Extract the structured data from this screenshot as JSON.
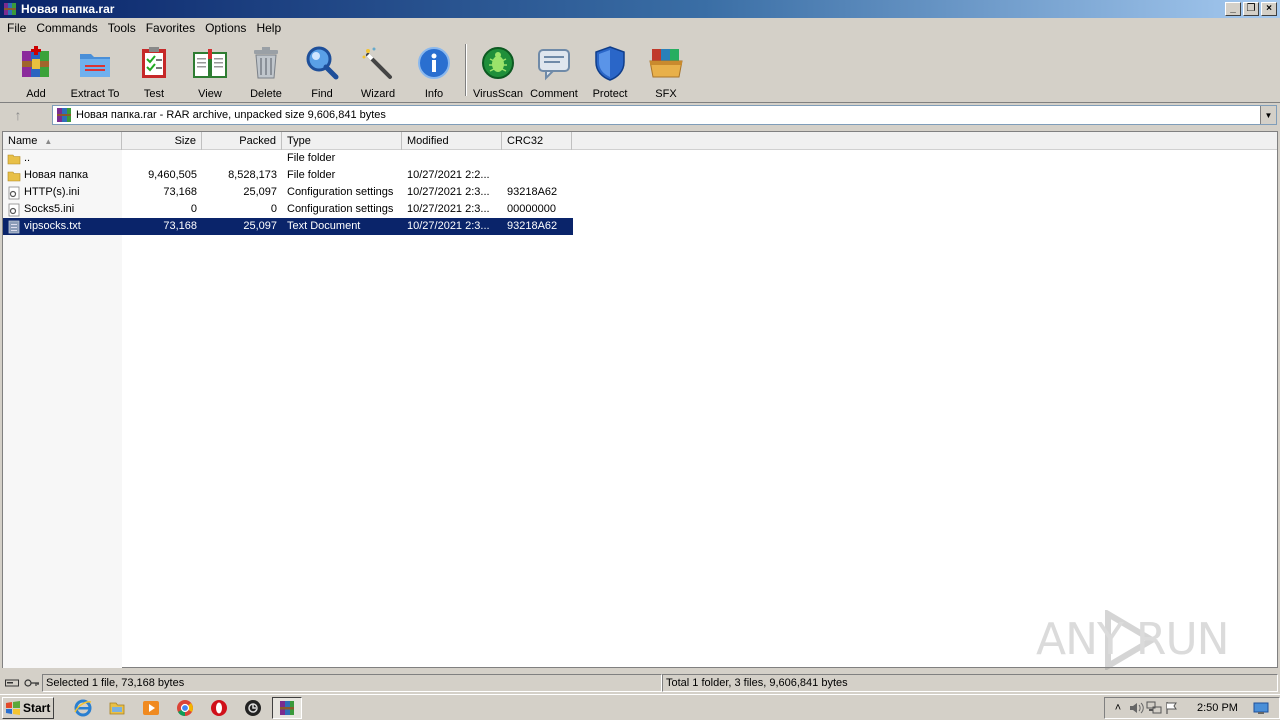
{
  "window": {
    "title": "Новая папка.rar"
  },
  "menu": [
    "File",
    "Commands",
    "Tools",
    "Favorites",
    "Options",
    "Help"
  ],
  "toolbar": {
    "add": "Add",
    "extract": "Extract To",
    "test": "Test",
    "view": "View",
    "delete": "Delete",
    "find": "Find",
    "wizard": "Wizard",
    "info": "Info",
    "virusscan": "VirusScan",
    "comment": "Comment",
    "protect": "Protect",
    "sfx": "SFX"
  },
  "address": {
    "text": "Новая папка.rar - RAR archive, unpacked size 9,606,841 bytes"
  },
  "columns": {
    "name": "Name",
    "size": "Size",
    "packed": "Packed",
    "type": "Type",
    "modified": "Modified",
    "crc": "CRC32"
  },
  "files": [
    {
      "name": "..",
      "size": "",
      "packed": "",
      "type": "File folder",
      "modified": "",
      "crc": "",
      "icon": "folder-icon"
    },
    {
      "name": "Новая папка",
      "size": "9,460,505",
      "packed": "8,528,173",
      "type": "File folder",
      "modified": "10/27/2021 2:2...",
      "crc": "",
      "icon": "folder-icon"
    },
    {
      "name": "HTTP(s).ini",
      "size": "73,168",
      "packed": "25,097",
      "type": "Configuration settings",
      "modified": "10/27/2021 2:3...",
      "crc": "93218A62",
      "icon": "settings-file-icon"
    },
    {
      "name": "Socks5.ini",
      "size": "0",
      "packed": "0",
      "type": "Configuration settings",
      "modified": "10/27/2021 2:3...",
      "crc": "00000000",
      "icon": "settings-file-icon"
    },
    {
      "name": "vipsocks.txt",
      "size": "73,168",
      "packed": "25,097",
      "type": "Text Document",
      "modified": "10/27/2021 2:3...",
      "crc": "93218A62",
      "icon": "text-file-icon",
      "selected": true
    }
  ],
  "status": {
    "left": "Selected 1 file, 73,168 bytes",
    "right": "Total 1 folder, 3 files, 9,606,841 bytes"
  },
  "watermark": "ANY RUN",
  "taskbar": {
    "start": "Start",
    "clock": "2:50 PM"
  }
}
